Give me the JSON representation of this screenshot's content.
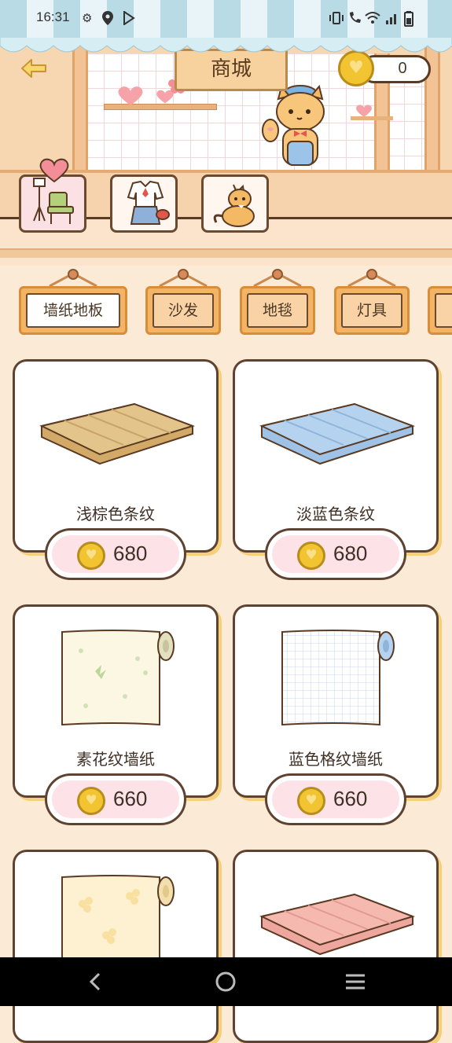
{
  "status_bar": {
    "time": "16:31",
    "left_icons": [
      "gear-icon",
      "location-pin-icon",
      "play-store-icon"
    ],
    "right_icons": [
      "vibrate-icon",
      "wifi-call-icon",
      "wifi-icon",
      "signal-icon",
      "battery-icon"
    ]
  },
  "header": {
    "title": "商城",
    "coins": "0"
  },
  "categories": [
    {
      "name": "furniture",
      "active": true
    },
    {
      "name": "clothing",
      "active": false
    },
    {
      "name": "cat",
      "active": false
    }
  ],
  "subtabs": [
    {
      "label": "墙纸地板",
      "active": true
    },
    {
      "label": "沙发",
      "active": false
    },
    {
      "label": "地毯",
      "active": false
    },
    {
      "label": "灯具",
      "active": false
    }
  ],
  "items": [
    {
      "name": "浅棕色条纹",
      "price": "680",
      "kind": "floor",
      "color": "#e3c48a"
    },
    {
      "name": "淡蓝色条纹",
      "price": "680",
      "kind": "floor",
      "color": "#b5d3ee"
    },
    {
      "name": "素花纹墙纸",
      "price": "660",
      "kind": "wallpaper",
      "color": "#fbf7e3"
    },
    {
      "name": "蓝色格纹墙纸",
      "price": "660",
      "kind": "wallpaper-grid",
      "color": "#ffffff"
    },
    {
      "name": "",
      "price": "",
      "kind": "wallpaper-flower",
      "color": "#fdf1d2"
    },
    {
      "name": "",
      "price": "",
      "kind": "floor",
      "color": "#f6b9b0"
    }
  ],
  "colors": {
    "accent_coin": "#f3c431",
    "card_border": "#5e4232",
    "card_shadow": "#f6cf7a",
    "background": "#fbead6"
  }
}
